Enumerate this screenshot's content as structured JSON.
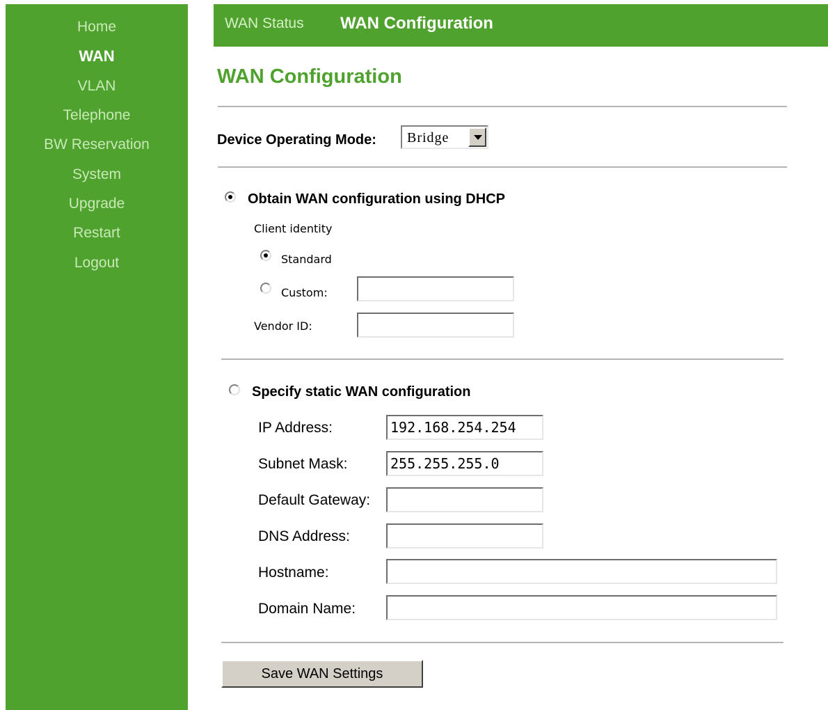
{
  "sidebar": {
    "items": [
      {
        "label": "Home"
      },
      {
        "label": "WAN"
      },
      {
        "label": "VLAN"
      },
      {
        "label": "Telephone"
      },
      {
        "label": "BW Reservation"
      },
      {
        "label": "System"
      },
      {
        "label": "Upgrade"
      },
      {
        "label": "Restart"
      },
      {
        "label": "Logout"
      }
    ],
    "active": "WAN"
  },
  "tabs": {
    "status": "WAN Status",
    "config": "WAN Configuration"
  },
  "page_title": "WAN Configuration",
  "mode": {
    "label": "Device Operating Mode:",
    "selected": "Bridge"
  },
  "dhcp": {
    "label": "Obtain WAN configuration using DHCP",
    "checked": true,
    "client_identity_label": "Client identity",
    "standard_label": "Standard",
    "custom_label": "Custom:",
    "custom_value": "",
    "vendor_label": "Vendor ID:",
    "vendor_value": ""
  },
  "static": {
    "label": "Specify static WAN configuration",
    "checked": false,
    "fields": [
      {
        "label": "IP Address:",
        "value": "192.168.254.254"
      },
      {
        "label": "Subnet Mask:",
        "value": "255.255.255.0"
      },
      {
        "label": "Default Gateway:",
        "value": ""
      },
      {
        "label": "DNS Address:",
        "value": ""
      },
      {
        "label": "Hostname:",
        "value": ""
      },
      {
        "label": "Domain Name:",
        "value": ""
      }
    ]
  },
  "save_label": "Save WAN Settings",
  "colors": {
    "brand_green": "#4ea22d",
    "nav_inactive": "#c9e9b8"
  }
}
